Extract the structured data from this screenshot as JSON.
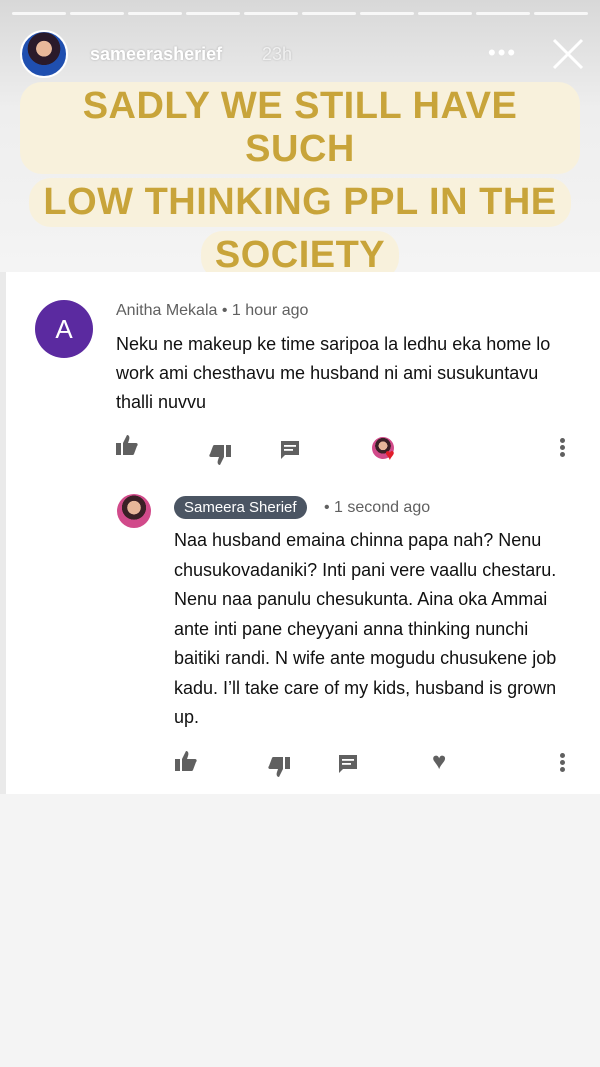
{
  "story": {
    "username": "sameerasherief",
    "time_ago": "23h",
    "more_icon": "more-horizontal-icon",
    "close_icon": "close-icon",
    "headline_lines": [
      "SADLY WE STILL HAVE SUCH",
      "LOW THINKING PPL IN THE",
      "SOCIETY"
    ],
    "headline_color": "#c8a43a",
    "headline_bg": "#f8f1dc",
    "progress_segments": 10
  },
  "comment": {
    "avatar_letter": "A",
    "avatar_color": "#5b2aa0",
    "author": "Anitha Mekala",
    "time": "1 hour ago",
    "text": "Neku ne makeup ke time saripoa la ledhu eka home lo work ami chesthavu me husband ni ami susukuntavu thalli nuvvu"
  },
  "reply": {
    "author": "Sameera Sherief",
    "time": "1 second ago",
    "text": "Naa husband emaina chinna papa nah? Nenu chusukovadaniki? Inti pani vere vaallu chestaru. Nenu naa panulu chesukunta. Aina oka Ammai ante inti pane cheyyani anna thinking nunchi baitiki randi. N wife ante mogudu chusukene job kadu. I’ll take care of my kids, husband is grown up."
  },
  "icons": {
    "like": "thumbs-up-icon",
    "dislike": "thumbs-down-icon",
    "reply": "reply-comment-icon",
    "heart": "heart-icon",
    "more": "more-vertical-icon"
  }
}
